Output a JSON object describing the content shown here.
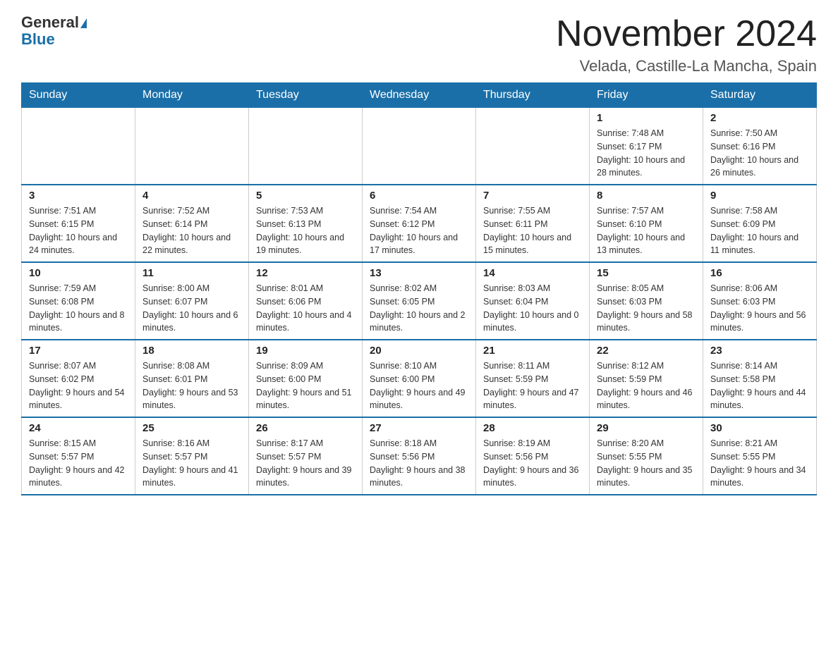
{
  "logo": {
    "general": "General",
    "blue": "Blue"
  },
  "title": "November 2024",
  "subtitle": "Velada, Castille-La Mancha, Spain",
  "days_of_week": [
    "Sunday",
    "Monday",
    "Tuesday",
    "Wednesday",
    "Thursday",
    "Friday",
    "Saturday"
  ],
  "weeks": [
    [
      {
        "day": "",
        "sunrise": "",
        "sunset": "",
        "daylight": ""
      },
      {
        "day": "",
        "sunrise": "",
        "sunset": "",
        "daylight": ""
      },
      {
        "day": "",
        "sunrise": "",
        "sunset": "",
        "daylight": ""
      },
      {
        "day": "",
        "sunrise": "",
        "sunset": "",
        "daylight": ""
      },
      {
        "day": "",
        "sunrise": "",
        "sunset": "",
        "daylight": ""
      },
      {
        "day": "1",
        "sunrise": "Sunrise: 7:48 AM",
        "sunset": "Sunset: 6:17 PM",
        "daylight": "Daylight: 10 hours and 28 minutes."
      },
      {
        "day": "2",
        "sunrise": "Sunrise: 7:50 AM",
        "sunset": "Sunset: 6:16 PM",
        "daylight": "Daylight: 10 hours and 26 minutes."
      }
    ],
    [
      {
        "day": "3",
        "sunrise": "Sunrise: 7:51 AM",
        "sunset": "Sunset: 6:15 PM",
        "daylight": "Daylight: 10 hours and 24 minutes."
      },
      {
        "day": "4",
        "sunrise": "Sunrise: 7:52 AM",
        "sunset": "Sunset: 6:14 PM",
        "daylight": "Daylight: 10 hours and 22 minutes."
      },
      {
        "day": "5",
        "sunrise": "Sunrise: 7:53 AM",
        "sunset": "Sunset: 6:13 PM",
        "daylight": "Daylight: 10 hours and 19 minutes."
      },
      {
        "day": "6",
        "sunrise": "Sunrise: 7:54 AM",
        "sunset": "Sunset: 6:12 PM",
        "daylight": "Daylight: 10 hours and 17 minutes."
      },
      {
        "day": "7",
        "sunrise": "Sunrise: 7:55 AM",
        "sunset": "Sunset: 6:11 PM",
        "daylight": "Daylight: 10 hours and 15 minutes."
      },
      {
        "day": "8",
        "sunrise": "Sunrise: 7:57 AM",
        "sunset": "Sunset: 6:10 PM",
        "daylight": "Daylight: 10 hours and 13 minutes."
      },
      {
        "day": "9",
        "sunrise": "Sunrise: 7:58 AM",
        "sunset": "Sunset: 6:09 PM",
        "daylight": "Daylight: 10 hours and 11 minutes."
      }
    ],
    [
      {
        "day": "10",
        "sunrise": "Sunrise: 7:59 AM",
        "sunset": "Sunset: 6:08 PM",
        "daylight": "Daylight: 10 hours and 8 minutes."
      },
      {
        "day": "11",
        "sunrise": "Sunrise: 8:00 AM",
        "sunset": "Sunset: 6:07 PM",
        "daylight": "Daylight: 10 hours and 6 minutes."
      },
      {
        "day": "12",
        "sunrise": "Sunrise: 8:01 AM",
        "sunset": "Sunset: 6:06 PM",
        "daylight": "Daylight: 10 hours and 4 minutes."
      },
      {
        "day": "13",
        "sunrise": "Sunrise: 8:02 AM",
        "sunset": "Sunset: 6:05 PM",
        "daylight": "Daylight: 10 hours and 2 minutes."
      },
      {
        "day": "14",
        "sunrise": "Sunrise: 8:03 AM",
        "sunset": "Sunset: 6:04 PM",
        "daylight": "Daylight: 10 hours and 0 minutes."
      },
      {
        "day": "15",
        "sunrise": "Sunrise: 8:05 AM",
        "sunset": "Sunset: 6:03 PM",
        "daylight": "Daylight: 9 hours and 58 minutes."
      },
      {
        "day": "16",
        "sunrise": "Sunrise: 8:06 AM",
        "sunset": "Sunset: 6:03 PM",
        "daylight": "Daylight: 9 hours and 56 minutes."
      }
    ],
    [
      {
        "day": "17",
        "sunrise": "Sunrise: 8:07 AM",
        "sunset": "Sunset: 6:02 PM",
        "daylight": "Daylight: 9 hours and 54 minutes."
      },
      {
        "day": "18",
        "sunrise": "Sunrise: 8:08 AM",
        "sunset": "Sunset: 6:01 PM",
        "daylight": "Daylight: 9 hours and 53 minutes."
      },
      {
        "day": "19",
        "sunrise": "Sunrise: 8:09 AM",
        "sunset": "Sunset: 6:00 PM",
        "daylight": "Daylight: 9 hours and 51 minutes."
      },
      {
        "day": "20",
        "sunrise": "Sunrise: 8:10 AM",
        "sunset": "Sunset: 6:00 PM",
        "daylight": "Daylight: 9 hours and 49 minutes."
      },
      {
        "day": "21",
        "sunrise": "Sunrise: 8:11 AM",
        "sunset": "Sunset: 5:59 PM",
        "daylight": "Daylight: 9 hours and 47 minutes."
      },
      {
        "day": "22",
        "sunrise": "Sunrise: 8:12 AM",
        "sunset": "Sunset: 5:59 PM",
        "daylight": "Daylight: 9 hours and 46 minutes."
      },
      {
        "day": "23",
        "sunrise": "Sunrise: 8:14 AM",
        "sunset": "Sunset: 5:58 PM",
        "daylight": "Daylight: 9 hours and 44 minutes."
      }
    ],
    [
      {
        "day": "24",
        "sunrise": "Sunrise: 8:15 AM",
        "sunset": "Sunset: 5:57 PM",
        "daylight": "Daylight: 9 hours and 42 minutes."
      },
      {
        "day": "25",
        "sunrise": "Sunrise: 8:16 AM",
        "sunset": "Sunset: 5:57 PM",
        "daylight": "Daylight: 9 hours and 41 minutes."
      },
      {
        "day": "26",
        "sunrise": "Sunrise: 8:17 AM",
        "sunset": "Sunset: 5:57 PM",
        "daylight": "Daylight: 9 hours and 39 minutes."
      },
      {
        "day": "27",
        "sunrise": "Sunrise: 8:18 AM",
        "sunset": "Sunset: 5:56 PM",
        "daylight": "Daylight: 9 hours and 38 minutes."
      },
      {
        "day": "28",
        "sunrise": "Sunrise: 8:19 AM",
        "sunset": "Sunset: 5:56 PM",
        "daylight": "Daylight: 9 hours and 36 minutes."
      },
      {
        "day": "29",
        "sunrise": "Sunrise: 8:20 AM",
        "sunset": "Sunset: 5:55 PM",
        "daylight": "Daylight: 9 hours and 35 minutes."
      },
      {
        "day": "30",
        "sunrise": "Sunrise: 8:21 AM",
        "sunset": "Sunset: 5:55 PM",
        "daylight": "Daylight: 9 hours and 34 minutes."
      }
    ]
  ]
}
